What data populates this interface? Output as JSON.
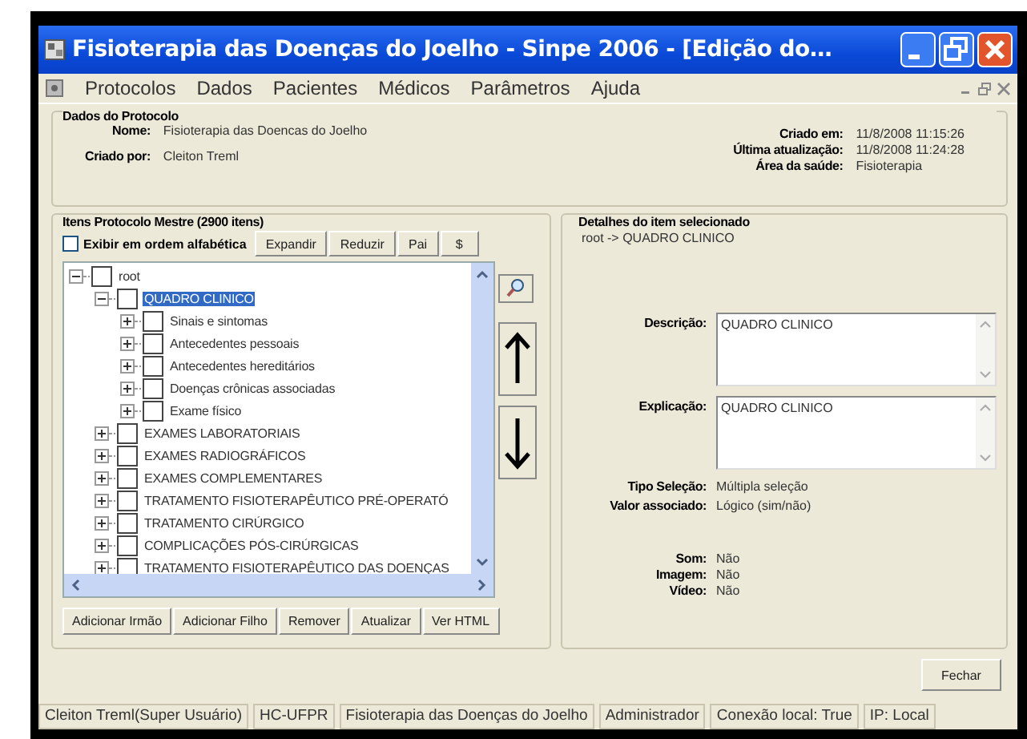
{
  "window": {
    "title": "Fisioterapia das Doenças do Joelho - Sinpe 2006 - [Edição do…"
  },
  "menu": [
    "Protocolos",
    "Dados",
    "Pacientes",
    "Médicos",
    "Parâmetros",
    "Ajuda"
  ],
  "protocol": {
    "title": "Dados do Protocolo",
    "left": [
      {
        "label": "Nome:",
        "value": "Fisioterapia das Doencas do Joelho"
      },
      {
        "label": "Criado por:",
        "value": "Cleiton Treml"
      }
    ],
    "right": [
      {
        "label": "Criado em:",
        "value": "11/8/2008 11:15:26"
      },
      {
        "label": "Última atualização:",
        "value": "11/8/2008 11:24:28"
      },
      {
        "label": "Área da saúde:",
        "value": "Fisioterapia"
      }
    ]
  },
  "master": {
    "title": "Itens Protocolo Mestre (2900 itens)",
    "alphabetical": {
      "label": "Exibir em ordem alfabética",
      "checked": false
    },
    "buttons": [
      "Expandir",
      "Reduzir",
      "Pai",
      "$"
    ],
    "tree": [
      {
        "label": "root",
        "expanded": true,
        "checked": false,
        "selected": false,
        "children": [
          {
            "label": "QUADRO CLINICO",
            "expanded": true,
            "checked": false,
            "selected": true,
            "children": [
              {
                "label": "Sinais e sintomas",
                "expanded": false,
                "checked": false,
                "selected": false
              },
              {
                "label": "Antecedentes pessoais",
                "expanded": false,
                "checked": false,
                "selected": false
              },
              {
                "label": "Antecedentes hereditários",
                "expanded": false,
                "checked": false,
                "selected": false
              },
              {
                "label": "Doenças crônicas associadas",
                "expanded": false,
                "checked": false,
                "selected": false
              },
              {
                "label": "Exame físico",
                "expanded": false,
                "checked": false,
                "selected": false
              }
            ]
          },
          {
            "label": "EXAMES LABORATORIAIS",
            "expanded": false,
            "checked": false,
            "selected": false
          },
          {
            "label": "EXAMES RADIOGRÁFICOS",
            "expanded": false,
            "checked": false,
            "selected": false
          },
          {
            "label": "EXAMES COMPLEMENTARES",
            "expanded": false,
            "checked": false,
            "selected": false
          },
          {
            "label": "TRATAMENTO FISIOTERAPÊUTICO PRÉ-OPERATÓ",
            "expanded": false,
            "checked": false,
            "selected": false
          },
          {
            "label": "TRATAMENTO CIRÚRGICO",
            "expanded": false,
            "checked": false,
            "selected": false
          },
          {
            "label": "COMPLICAÇÕES PÓS-CIRÚRGICAS",
            "expanded": false,
            "checked": false,
            "selected": false
          },
          {
            "label": "TRATAMENTO FISIOTERAPÊUTICO DAS DOENÇAS",
            "expanded": false,
            "checked": false,
            "selected": false
          }
        ]
      }
    ],
    "actions": [
      "Adicionar Irmão",
      "Adicionar Filho",
      "Remover",
      "Atualizar",
      "Ver HTML"
    ]
  },
  "details": {
    "title": "Detalhes do item selecionado",
    "path": "root -> QUADRO CLINICO",
    "fields": [
      {
        "label": "Descrição:",
        "value": "QUADRO CLINICO"
      },
      {
        "label": "Explicação:",
        "value": "QUADRO CLINICO"
      }
    ],
    "info": [
      {
        "label": "Tipo Seleção:",
        "value": "Múltipla seleção"
      },
      {
        "label": "Valor associado:",
        "value": "Lógico (sim/não)"
      }
    ],
    "media": [
      {
        "label": "Som:",
        "value": "Não"
      },
      {
        "label": "Imagem:",
        "value": "Não"
      },
      {
        "label": "Vídeo:",
        "value": "Não"
      }
    ]
  },
  "close_button": "Fechar",
  "status_bar": [
    "Cleiton Treml(Super Usuário)",
    "HC-UFPR",
    "Fisioterapia das Doenças do Joelho",
    "Administrador",
    "Conexão local: True",
    "IP: Local"
  ]
}
